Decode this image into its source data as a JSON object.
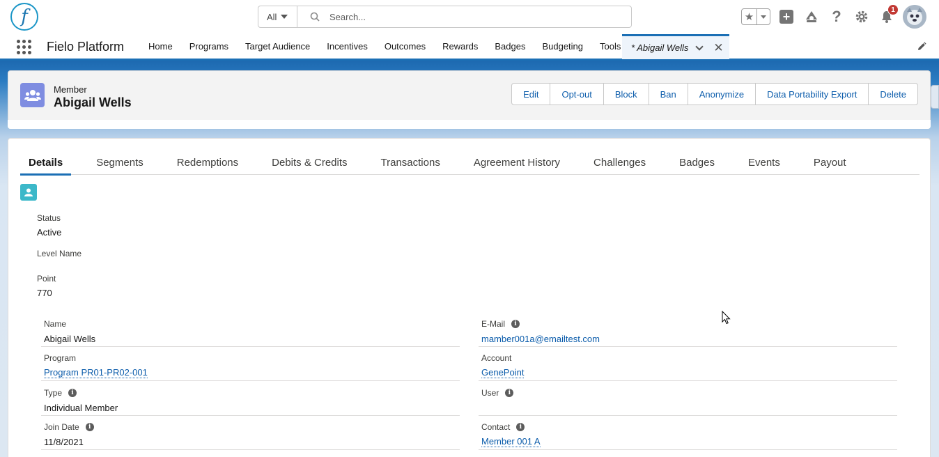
{
  "header": {
    "logo_letter": "f",
    "search_scope": "All",
    "search_placeholder": "Search...",
    "notification_count": "1"
  },
  "nav": {
    "app_name": "Fielo Platform",
    "items": [
      "Home",
      "Programs",
      "Target Audience",
      "Incentives",
      "Outcomes",
      "Rewards",
      "Badges",
      "Budgeting",
      "Tools"
    ],
    "active_tab": "* Abigail Wells"
  },
  "record": {
    "object_type": "Member",
    "name": "Abigail Wells",
    "actions": [
      "Edit",
      "Opt-out",
      "Block",
      "Ban",
      "Anonymize",
      "Data Portability Export",
      "Delete"
    ]
  },
  "tabs": [
    "Details",
    "Segments",
    "Redemptions",
    "Debits & Credits",
    "Transactions",
    "Agreement History",
    "Challenges",
    "Badges",
    "Events",
    "Payout"
  ],
  "summary": {
    "status_label": "Status",
    "status_value": "Active",
    "level_label": "Level Name",
    "level_value": "",
    "point_label": "Point",
    "point_value": "770"
  },
  "fields_left": [
    {
      "label": "Name",
      "value": "Abigail Wells"
    },
    {
      "label": "Program",
      "value": "Program PR01-PR02-001"
    },
    {
      "label": "Type",
      "value": "Individual Member"
    },
    {
      "label": "Join Date",
      "value": "11/8/2021"
    }
  ],
  "fields_right": [
    {
      "label": "E-Mail",
      "value": "mamber001a@emailtest.com"
    },
    {
      "label": "Account",
      "value": "GenePoint"
    },
    {
      "label": "User",
      "value": ""
    },
    {
      "label": "Contact",
      "value": "Member 001 A"
    }
  ],
  "colors": {
    "brand_blue": "#1b6fb5",
    "link": "#0b5cab",
    "member_icon": "#7f8de1",
    "contact_icon": "#3cb8c9",
    "badge_red": "#c23934"
  }
}
